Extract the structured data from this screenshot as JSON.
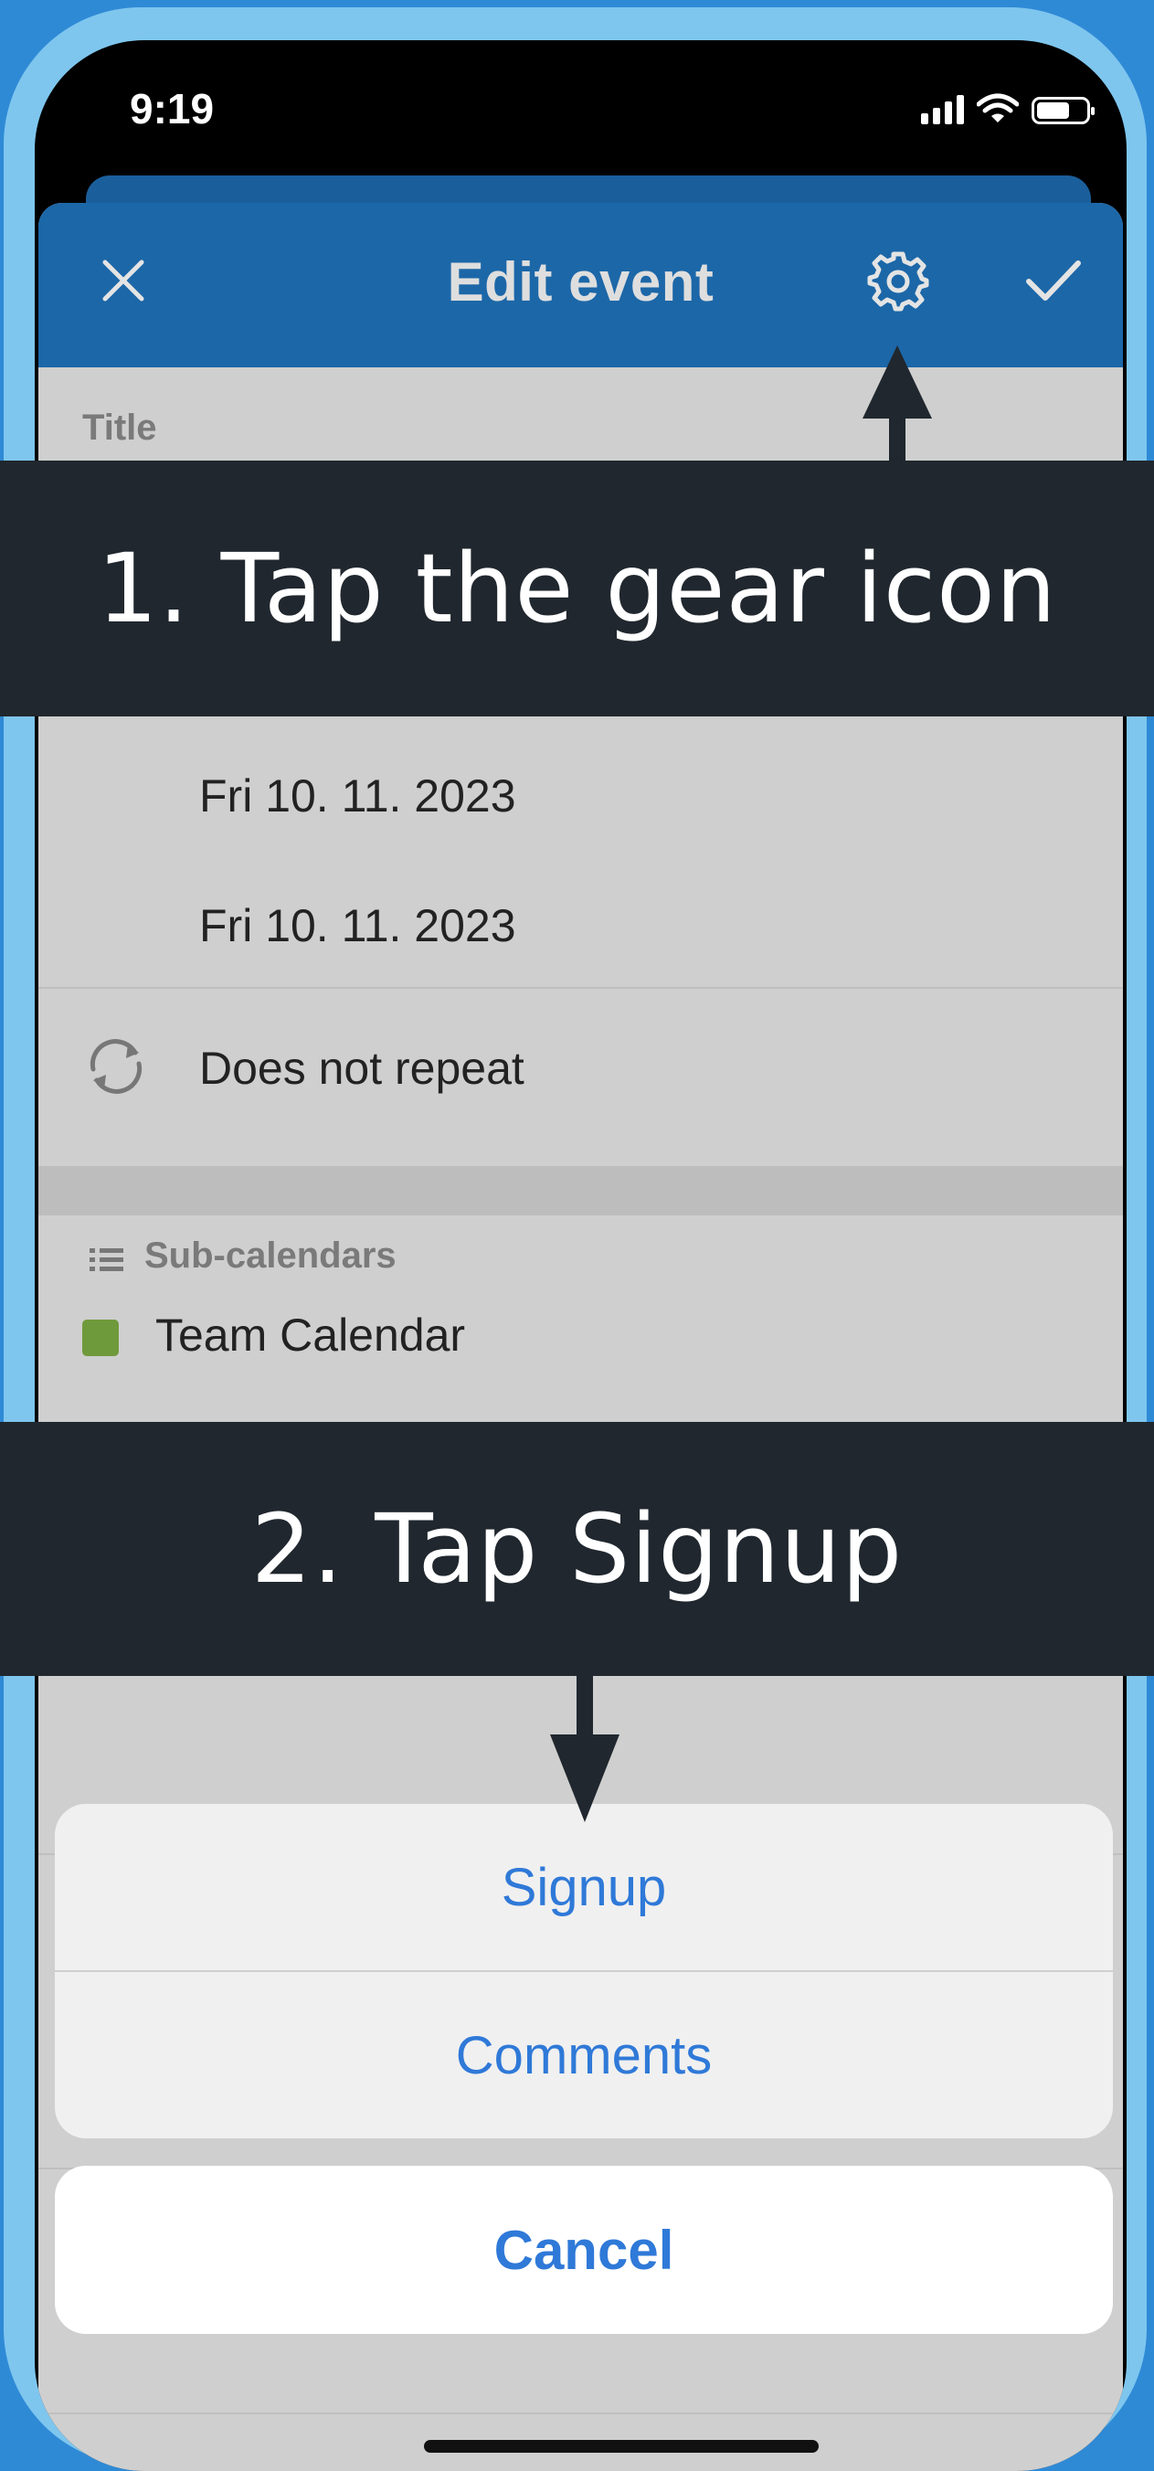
{
  "status_bar": {
    "time": "9:19"
  },
  "header": {
    "title": "Edit event",
    "close_icon": "close-icon",
    "settings_icon": "gear-icon",
    "save_icon": "checkmark-icon"
  },
  "form": {
    "title_label": "Title",
    "start_date": "Fri 10. 11. 2023",
    "end_date": "Fri 10. 11. 2023",
    "repeat_label": "Does not repeat",
    "subcalendars_label": "Sub-calendars",
    "subcalendar_name": "Team Calendar",
    "subcalendar_color": "#6f9a3c"
  },
  "action_sheet": {
    "options": [
      "Signup",
      "Comments"
    ],
    "cancel_label": "Cancel"
  },
  "instructions": {
    "step1": "1.  Tap the gear icon",
    "step2": "2. Tap Signup"
  },
  "colors": {
    "header_blue": "#1c67a8",
    "action_blue": "#2f79d8",
    "banner_dark": "#20272e"
  }
}
